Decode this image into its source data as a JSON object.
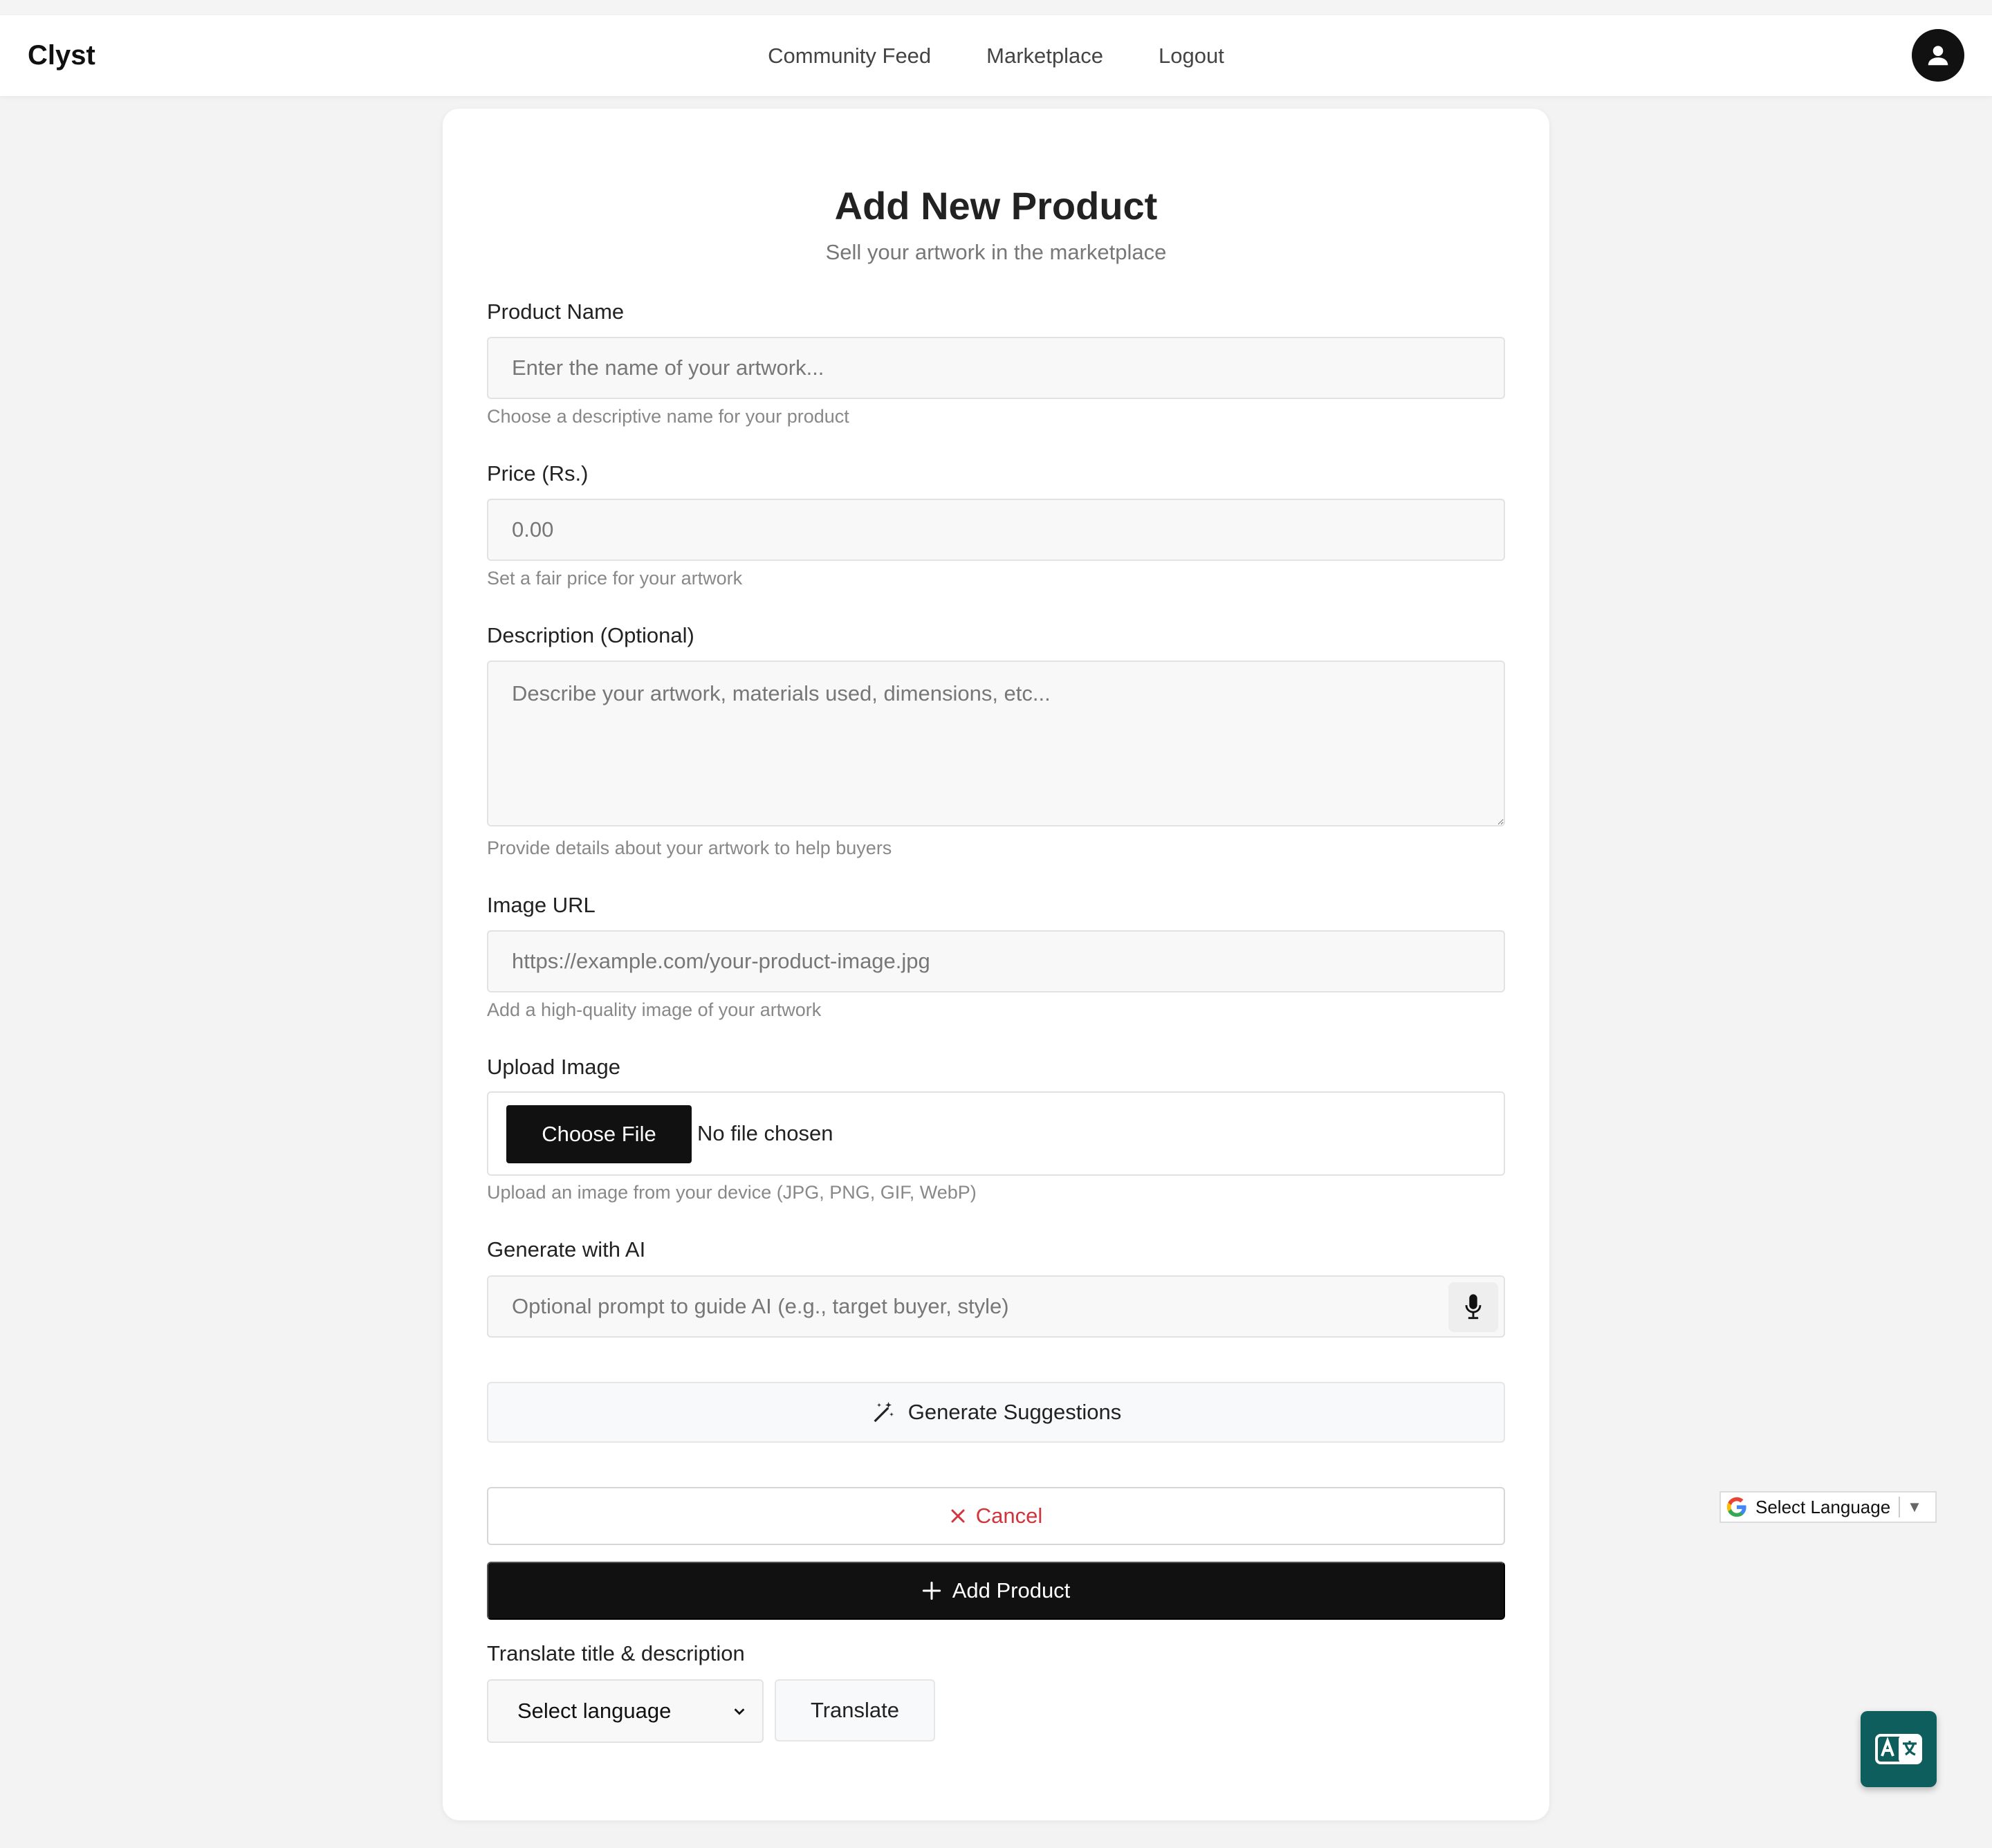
{
  "header": {
    "brand": "Clyst",
    "nav": [
      "Community Feed",
      "Marketplace",
      "Logout"
    ]
  },
  "form": {
    "title": "Add New Product",
    "subtitle": "Sell your artwork in the marketplace",
    "product_name": {
      "label": "Product Name",
      "placeholder": "Enter the name of your artwork...",
      "help": "Choose a descriptive name for your product"
    },
    "price": {
      "label": "Price (Rs.)",
      "placeholder": "0.00",
      "help": "Set a fair price for your artwork"
    },
    "description": {
      "label": "Description (Optional)",
      "placeholder": "Describe your artwork, materials used, dimensions, etc...",
      "help": "Provide details about your artwork to help buyers"
    },
    "image_url": {
      "label": "Image URL",
      "placeholder": "https://example.com/your-product-image.jpg",
      "help": "Add a high-quality image of your artwork"
    },
    "upload": {
      "label": "Upload Image",
      "button": "Choose File",
      "status": "No file chosen",
      "help": "Upload an image from your device (JPG, PNG, GIF, WebP)"
    },
    "ai": {
      "label": "Generate with AI",
      "placeholder": "Optional prompt to guide AI (e.g., target buyer, style)",
      "generate_button": "Generate Suggestions"
    },
    "cancel_button": "Cancel",
    "submit_button": "Add Product",
    "translate": {
      "label": "Translate title & description",
      "select_value": "Select language",
      "button": "Translate"
    }
  },
  "google_translate": {
    "label": "Select Language"
  },
  "colors": {
    "accent": "#111111",
    "cancel": "#d0343c",
    "fab": "#0f5e5e",
    "background": "#f3f3f3"
  }
}
